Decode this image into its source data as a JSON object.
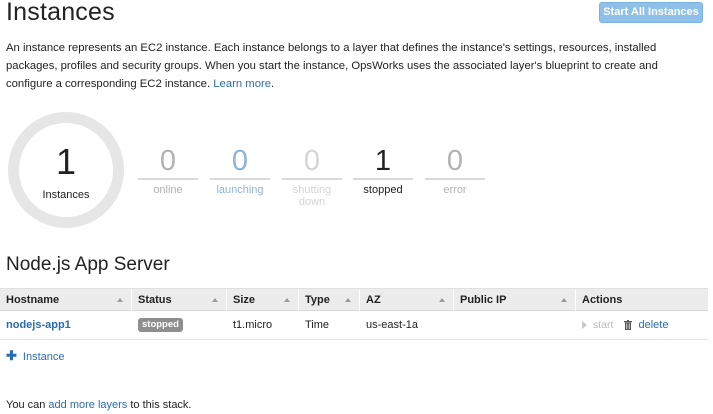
{
  "header": {
    "title": "Instances",
    "start_all_label": "Start All Instances"
  },
  "intro": {
    "text": "An instance represents an EC2 instance. Each instance belongs to a layer that defines the instance's settings, resources, installed packages, profiles and security groups. When you start the instance, OpsWorks uses the associated layer's blueprint to create and configure a corresponding EC2 instance.",
    "link_label": "Learn more",
    "suffix": "."
  },
  "summary": {
    "total_count": "1",
    "total_label": "Instances",
    "stats": [
      {
        "count": "0",
        "label": "online",
        "color": "#b3b3b3"
      },
      {
        "count": "0",
        "label": "launching",
        "color": "#8fb3d6"
      },
      {
        "count": "0",
        "label": "shutting down",
        "color": "#d4d4d4"
      },
      {
        "count": "1",
        "label": "stopped",
        "color": "#222222"
      },
      {
        "count": "0",
        "label": "error",
        "color": "#b3b3b3"
      }
    ]
  },
  "layer": {
    "title": "Node.js App Server",
    "columns": [
      "Hostname",
      "Status",
      "Size",
      "Type",
      "AZ",
      "Public IP",
      "Actions"
    ],
    "rows": [
      {
        "hostname": "nodejs-app1",
        "status": "stopped",
        "size": "t1.micro",
        "type": "Time",
        "az": "us-east-1a",
        "public_ip": "",
        "start_label": "start",
        "delete_label": "delete"
      }
    ],
    "add_instance_label": "Instance"
  },
  "footer": {
    "prefix": "You can",
    "link_label": "add more layers",
    "suffix": "to this stack."
  }
}
